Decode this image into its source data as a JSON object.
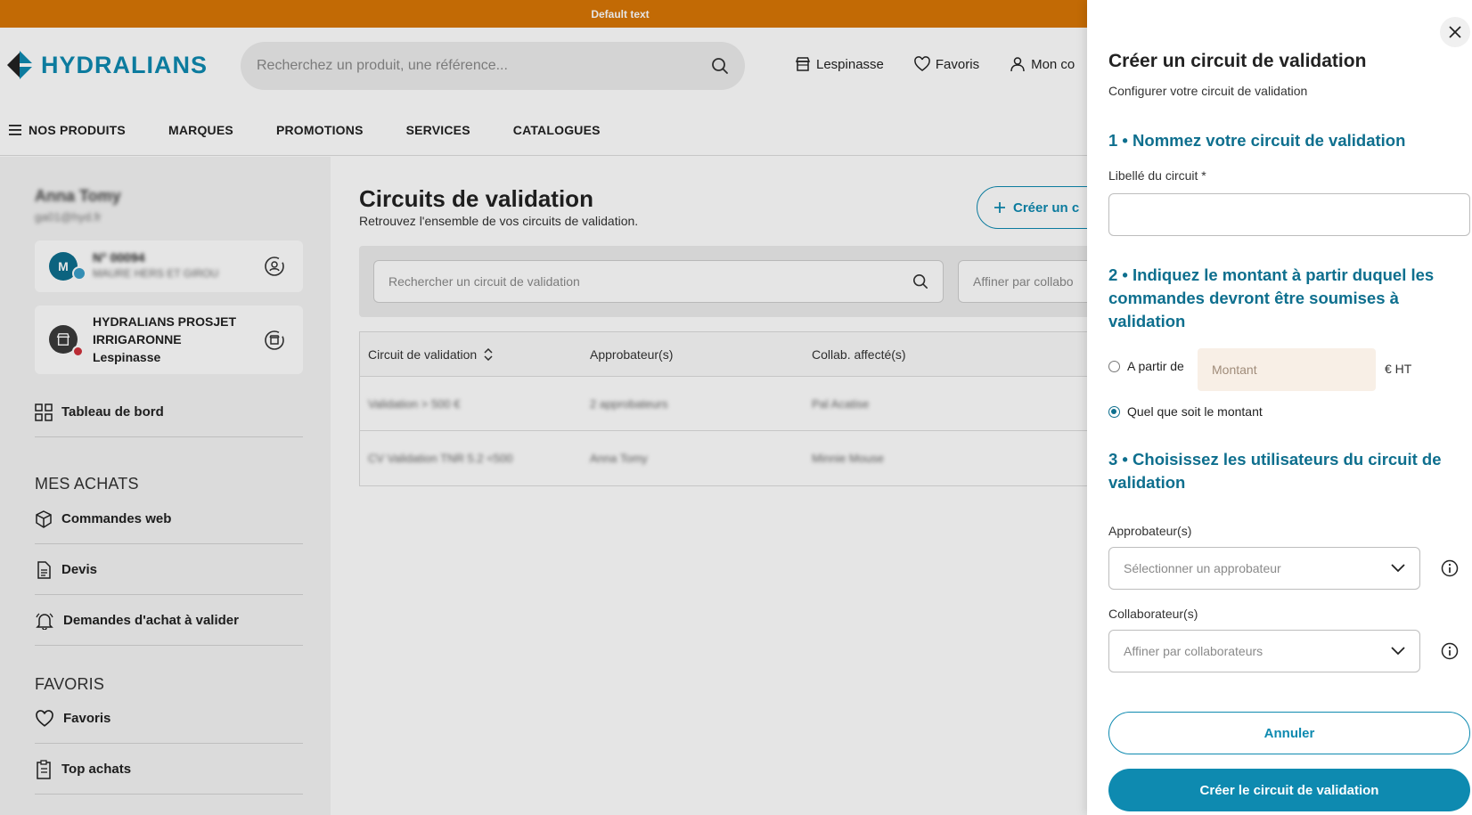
{
  "banner": {
    "text": "Default text"
  },
  "header": {
    "logo_text": "HYDRALIANS",
    "search_placeholder": "Recherchez un produit, une référence...",
    "links": {
      "store": "Lespinasse",
      "favorites": "Favoris",
      "account": "Mon co"
    }
  },
  "nav": {
    "products": "NOS PRODUITS",
    "brands": "MARQUES",
    "promotions": "PROMOTIONS",
    "services": "SERVICES",
    "catalogues": "CATALOGUES"
  },
  "sidebar": {
    "user_name": "Anna Tomy",
    "user_email": "ga01@hyd.fr",
    "account_card": {
      "avatar": "M",
      "number": "N° 00094",
      "name": "MAURE HERS ET GIROU"
    },
    "agency_card": {
      "name": "HYDRALIANS PROSJET IRRIGARONNE Lespinasse"
    },
    "dashboard": "Tableau de bord",
    "section_purchases": "MES ACHATS",
    "web_orders": "Commandes web",
    "quotes": "Devis",
    "purchase_requests": "Demandes d'achat à valider",
    "section_favorites": "FAVORIS",
    "favorites": "Favoris",
    "top_purchases": "Top achats"
  },
  "main": {
    "title": "Circuits de validation",
    "subtitle": "Retrouvez l'ensemble de vos circuits de validation.",
    "create_button": "Créer un c",
    "search_placeholder": "Rechercher un circuit de validation",
    "filter_placeholder": "Affiner par collabo",
    "table": {
      "headers": [
        "Circuit de validation",
        "Approbateur(s)",
        "Collab. affecté(s)"
      ],
      "rows": [
        [
          "Validation > 500 €",
          "2 approbateurs",
          "Pal Acatise"
        ],
        [
          "CV Validation TNR 5.2 <500",
          "Anna Tomy",
          "Minnie Mouse"
        ]
      ]
    }
  },
  "drawer": {
    "title": "Créer un circuit de validation",
    "subtitle": "Configurer votre circuit de validation",
    "step1": "1 • Nommez votre circuit de validation",
    "label_name": "Libellé du circuit *",
    "name_value": "",
    "step2": "2 • Indiquez le montant à partir duquel les commandes devront être soumises à validation",
    "radio_from": "A partir de",
    "amount_placeholder": "Montant",
    "unit": "€ HT",
    "radio_any": "Quel que soit le montant",
    "step3": "3 • Choisissez les utilisateurs du circuit de validation",
    "label_approvers": "Approbateur(s)",
    "approvers_placeholder": "Sélectionner un approbateur",
    "label_collaborators": "Collaborateur(s)",
    "collaborators_placeholder": "Affiner par collaborateurs",
    "cancel": "Annuler",
    "submit": "Créer le circuit de validation"
  }
}
